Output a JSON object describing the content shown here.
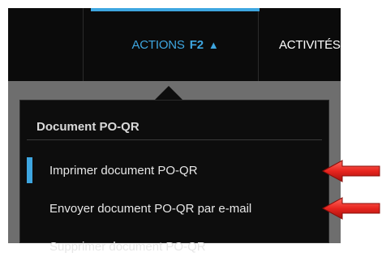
{
  "toolbar": {
    "actions_tab": {
      "label": "ACTIONS",
      "shortcut": "F2",
      "chevron": "▲"
    },
    "activites_tab": {
      "label": "ACTIVITÉS"
    }
  },
  "menu": {
    "title": "Document PO-QR",
    "items": [
      {
        "label": "Imprimer document PO-QR"
      },
      {
        "label": "Envoyer document PO-QR par e-mail"
      },
      {
        "label": "Supprimer document PO-QR"
      }
    ]
  },
  "icons": {
    "chevron": "chevron-up-icon",
    "arrow": "red-arrow-pointer-icon"
  },
  "colors": {
    "accent": "#3ea6e0",
    "toolbar_bg": "#0b0b0b",
    "backdrop": "#6e6e6e",
    "annotation_arrow": "#e8251f"
  }
}
